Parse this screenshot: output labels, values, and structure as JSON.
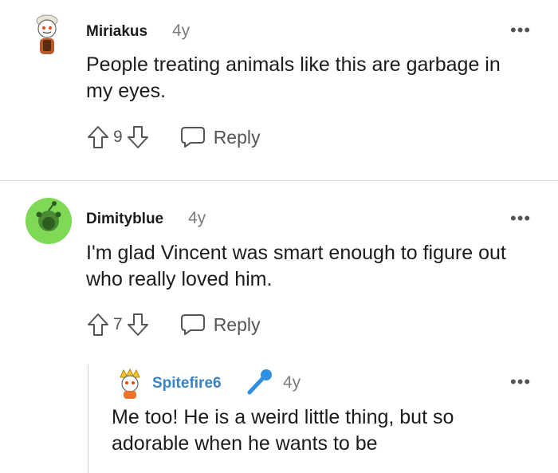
{
  "comments": [
    {
      "username": "Miriakus",
      "age": "4y",
      "text": "People treating animals like this are garbage in my eyes.",
      "score": "9",
      "reply_label": "Reply",
      "more_label": "•••"
    },
    {
      "username": "Dimityblue",
      "age": "4y",
      "text": "I'm glad Vincent was smart enough to figure out who really loved him.",
      "score": "7",
      "reply_label": "Reply",
      "more_label": "•••"
    },
    {
      "username": "Spitefire6",
      "age": "4y",
      "text": "Me too! He is a weird little thing, but so adorable when he wants to be",
      "more_label": "•••",
      "badge_icon": "microphone-icon"
    }
  ],
  "colors": {
    "avatar_green": "#7ed957",
    "username_blue": "#3b82c4",
    "mic_blue": "#2f8fe0",
    "divider": "#e0e0e0"
  }
}
